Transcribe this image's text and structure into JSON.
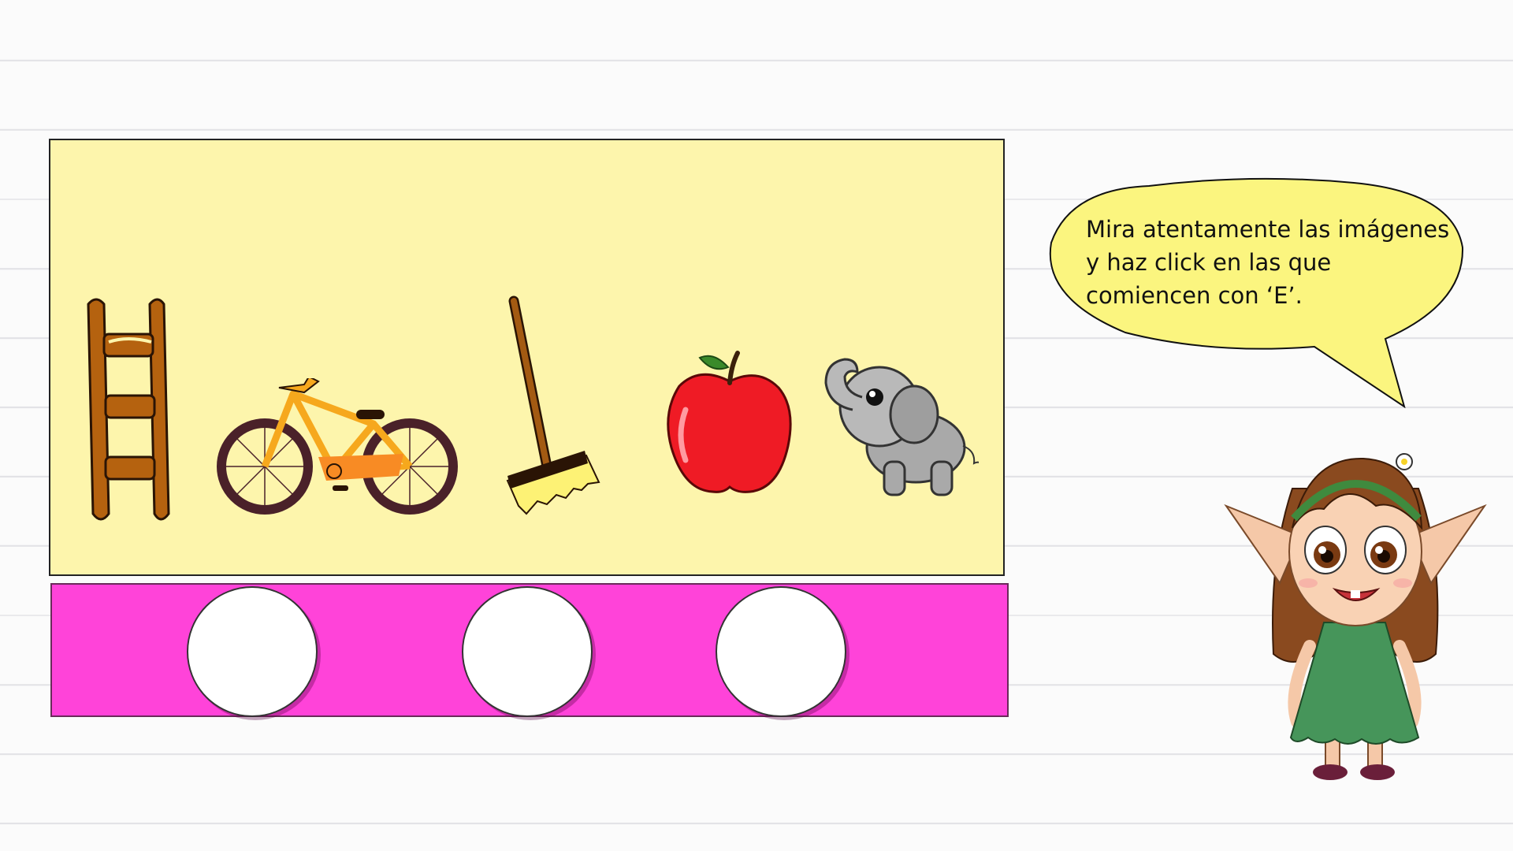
{
  "instruction": {
    "text": "Mira atentamente las imágenes y haz click en las que comiencen con ‘E’."
  },
  "images": [
    {
      "id": "ladder",
      "icon": "ladder-icon",
      "color": "#b5620f"
    },
    {
      "id": "bicycle",
      "icon": "bicycle-icon",
      "color": "#f6a81d"
    },
    {
      "id": "broom",
      "icon": "broom-icon",
      "color": "#a35a12"
    },
    {
      "id": "apple",
      "icon": "apple-icon",
      "color": "#ef1b25"
    },
    {
      "id": "elephant",
      "icon": "elephant-icon",
      "color": "#a9a9a9"
    }
  ],
  "answer_slots": [
    {
      "id": "slot-1",
      "value": ""
    },
    {
      "id": "slot-2",
      "value": ""
    },
    {
      "id": "slot-3",
      "value": ""
    }
  ],
  "colors": {
    "stage": "#fdf5ac",
    "answer_bar": "#ff43d9",
    "bubble": "#fbf57f"
  }
}
